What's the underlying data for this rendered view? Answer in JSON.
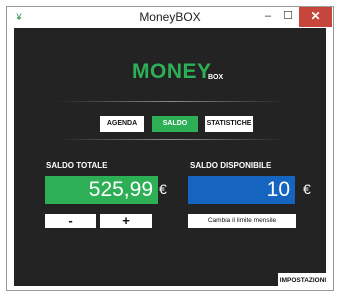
{
  "window": {
    "title": "MoneyBOX",
    "app_icon": "moneybox-icon",
    "minimize_glyph": "–",
    "maximize_glyph": "☐",
    "close_glyph": "✕"
  },
  "logo": {
    "main": "MONEY",
    "sub": "BOX"
  },
  "tabs": [
    {
      "label": "AGENDA",
      "active": false
    },
    {
      "label": "SALDO",
      "active": true
    },
    {
      "label": "STATISTICHE",
      "active": false
    }
  ],
  "saldo_totale": {
    "label": "SALDO TOTALE",
    "value": "525,99",
    "currency": "€",
    "minus_label": "-",
    "plus_label": "+"
  },
  "saldo_disponibile": {
    "label": "SALDO DISPONIBILE",
    "value": "10",
    "currency": "€",
    "limit_button": "Cambia il limite mensile"
  },
  "settings_button": "IMPOSTAZIONI",
  "colors": {
    "background": "#232323",
    "green": "#2db055",
    "blue": "#1565c0",
    "close_red": "#c7463c"
  }
}
